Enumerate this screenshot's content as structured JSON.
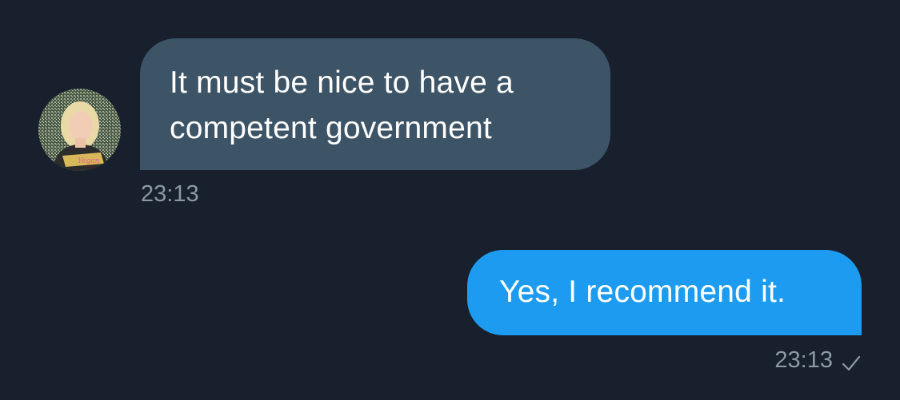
{
  "conversation": {
    "incoming": {
      "text": "It must be nice to have a competent government",
      "time": "23:13",
      "avatar_badge": "Yegan"
    },
    "outgoing": {
      "text": "Yes, I recommend it.",
      "time": "23:13",
      "status_icon": "check-icon"
    }
  },
  "colors": {
    "background": "#17202c",
    "incoming_bubble": "#3d5466",
    "outgoing_bubble": "#1d9bf0",
    "timestamp": "#8b98a5"
  }
}
